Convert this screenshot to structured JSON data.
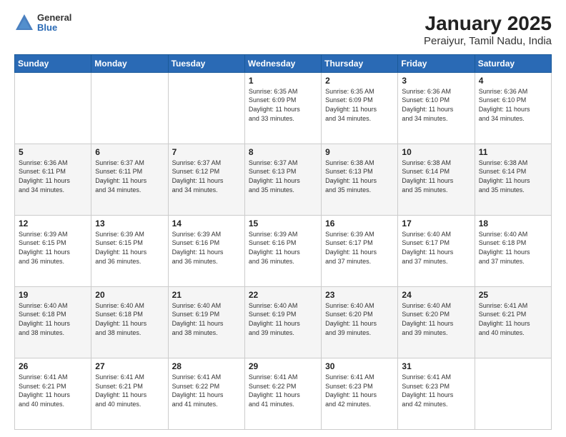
{
  "logo": {
    "general": "General",
    "blue": "Blue"
  },
  "title": "January 2025",
  "subtitle": "Peraiyur, Tamil Nadu, India",
  "weekdays": [
    "Sunday",
    "Monday",
    "Tuesday",
    "Wednesday",
    "Thursday",
    "Friday",
    "Saturday"
  ],
  "weeks": [
    [
      {
        "day": "",
        "info": ""
      },
      {
        "day": "",
        "info": ""
      },
      {
        "day": "",
        "info": ""
      },
      {
        "day": "1",
        "info": "Sunrise: 6:35 AM\nSunset: 6:09 PM\nDaylight: 11 hours\nand 33 minutes."
      },
      {
        "day": "2",
        "info": "Sunrise: 6:35 AM\nSunset: 6:09 PM\nDaylight: 11 hours\nand 34 minutes."
      },
      {
        "day": "3",
        "info": "Sunrise: 6:36 AM\nSunset: 6:10 PM\nDaylight: 11 hours\nand 34 minutes."
      },
      {
        "day": "4",
        "info": "Sunrise: 6:36 AM\nSunset: 6:10 PM\nDaylight: 11 hours\nand 34 minutes."
      }
    ],
    [
      {
        "day": "5",
        "info": "Sunrise: 6:36 AM\nSunset: 6:11 PM\nDaylight: 11 hours\nand 34 minutes."
      },
      {
        "day": "6",
        "info": "Sunrise: 6:37 AM\nSunset: 6:11 PM\nDaylight: 11 hours\nand 34 minutes."
      },
      {
        "day": "7",
        "info": "Sunrise: 6:37 AM\nSunset: 6:12 PM\nDaylight: 11 hours\nand 34 minutes."
      },
      {
        "day": "8",
        "info": "Sunrise: 6:37 AM\nSunset: 6:13 PM\nDaylight: 11 hours\nand 35 minutes."
      },
      {
        "day": "9",
        "info": "Sunrise: 6:38 AM\nSunset: 6:13 PM\nDaylight: 11 hours\nand 35 minutes."
      },
      {
        "day": "10",
        "info": "Sunrise: 6:38 AM\nSunset: 6:14 PM\nDaylight: 11 hours\nand 35 minutes."
      },
      {
        "day": "11",
        "info": "Sunrise: 6:38 AM\nSunset: 6:14 PM\nDaylight: 11 hours\nand 35 minutes."
      }
    ],
    [
      {
        "day": "12",
        "info": "Sunrise: 6:39 AM\nSunset: 6:15 PM\nDaylight: 11 hours\nand 36 minutes."
      },
      {
        "day": "13",
        "info": "Sunrise: 6:39 AM\nSunset: 6:15 PM\nDaylight: 11 hours\nand 36 minutes."
      },
      {
        "day": "14",
        "info": "Sunrise: 6:39 AM\nSunset: 6:16 PM\nDaylight: 11 hours\nand 36 minutes."
      },
      {
        "day": "15",
        "info": "Sunrise: 6:39 AM\nSunset: 6:16 PM\nDaylight: 11 hours\nand 36 minutes."
      },
      {
        "day": "16",
        "info": "Sunrise: 6:39 AM\nSunset: 6:17 PM\nDaylight: 11 hours\nand 37 minutes."
      },
      {
        "day": "17",
        "info": "Sunrise: 6:40 AM\nSunset: 6:17 PM\nDaylight: 11 hours\nand 37 minutes."
      },
      {
        "day": "18",
        "info": "Sunrise: 6:40 AM\nSunset: 6:18 PM\nDaylight: 11 hours\nand 37 minutes."
      }
    ],
    [
      {
        "day": "19",
        "info": "Sunrise: 6:40 AM\nSunset: 6:18 PM\nDaylight: 11 hours\nand 38 minutes."
      },
      {
        "day": "20",
        "info": "Sunrise: 6:40 AM\nSunset: 6:18 PM\nDaylight: 11 hours\nand 38 minutes."
      },
      {
        "day": "21",
        "info": "Sunrise: 6:40 AM\nSunset: 6:19 PM\nDaylight: 11 hours\nand 38 minutes."
      },
      {
        "day": "22",
        "info": "Sunrise: 6:40 AM\nSunset: 6:19 PM\nDaylight: 11 hours\nand 39 minutes."
      },
      {
        "day": "23",
        "info": "Sunrise: 6:40 AM\nSunset: 6:20 PM\nDaylight: 11 hours\nand 39 minutes."
      },
      {
        "day": "24",
        "info": "Sunrise: 6:40 AM\nSunset: 6:20 PM\nDaylight: 11 hours\nand 39 minutes."
      },
      {
        "day": "25",
        "info": "Sunrise: 6:41 AM\nSunset: 6:21 PM\nDaylight: 11 hours\nand 40 minutes."
      }
    ],
    [
      {
        "day": "26",
        "info": "Sunrise: 6:41 AM\nSunset: 6:21 PM\nDaylight: 11 hours\nand 40 minutes."
      },
      {
        "day": "27",
        "info": "Sunrise: 6:41 AM\nSunset: 6:21 PM\nDaylight: 11 hours\nand 40 minutes."
      },
      {
        "day": "28",
        "info": "Sunrise: 6:41 AM\nSunset: 6:22 PM\nDaylight: 11 hours\nand 41 minutes."
      },
      {
        "day": "29",
        "info": "Sunrise: 6:41 AM\nSunset: 6:22 PM\nDaylight: 11 hours\nand 41 minutes."
      },
      {
        "day": "30",
        "info": "Sunrise: 6:41 AM\nSunset: 6:23 PM\nDaylight: 11 hours\nand 42 minutes."
      },
      {
        "day": "31",
        "info": "Sunrise: 6:41 AM\nSunset: 6:23 PM\nDaylight: 11 hours\nand 42 minutes."
      },
      {
        "day": "",
        "info": ""
      }
    ]
  ]
}
